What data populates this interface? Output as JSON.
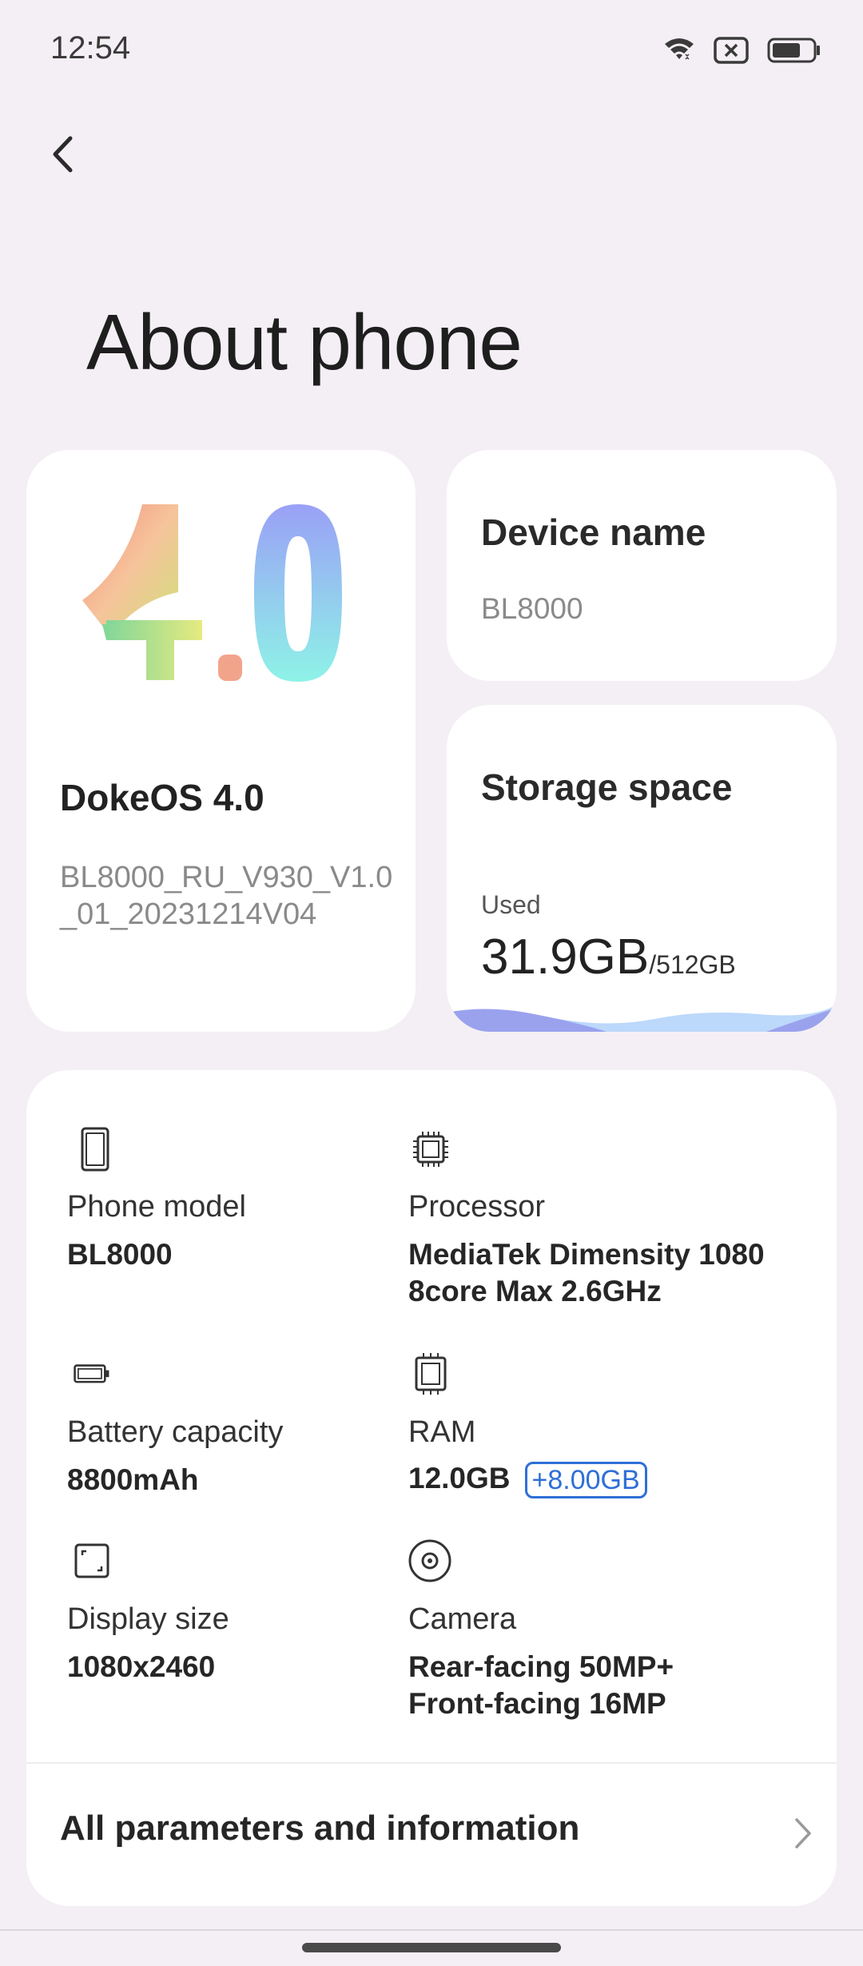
{
  "status_bar": {
    "time": "12:54"
  },
  "header": {
    "title": "About phone"
  },
  "os_card": {
    "name": "DokeOS 4.0",
    "build": "BL8000_RU_V930_V1.0_01_20231214V04"
  },
  "device_card": {
    "title": "Device name",
    "value": "BL8000"
  },
  "storage_card": {
    "title": "Storage space",
    "used_label": "Used",
    "used": "31.9GB",
    "total": "/512GB",
    "used_fraction": 0.062
  },
  "specs": {
    "phone_model": {
      "label": "Phone model",
      "value": "BL8000",
      "icon": "phone-icon"
    },
    "processor": {
      "label": "Processor",
      "value": "MediaTek Dimensity 1080 8core Max 2.6GHz",
      "icon": "chip-icon"
    },
    "battery": {
      "label": "Battery capacity",
      "value": "8800mAh",
      "icon": "battery-icon"
    },
    "ram": {
      "label": "RAM",
      "value": "12.0GB",
      "extra": "+8.00GB",
      "icon": "memory-icon"
    },
    "display": {
      "label": "Display size",
      "value": "1080x2460",
      "icon": "display-icon"
    },
    "camera": {
      "label": "Camera",
      "value_line1": "Rear-facing 50MP+",
      "value_line2": "Front-facing 16MP",
      "icon": "camera-icon"
    }
  },
  "all_params": {
    "label": "All parameters and information"
  },
  "colors": {
    "background": "#f4eff4",
    "card": "#ffffff",
    "accent_blue": "#2f6fd6"
  }
}
